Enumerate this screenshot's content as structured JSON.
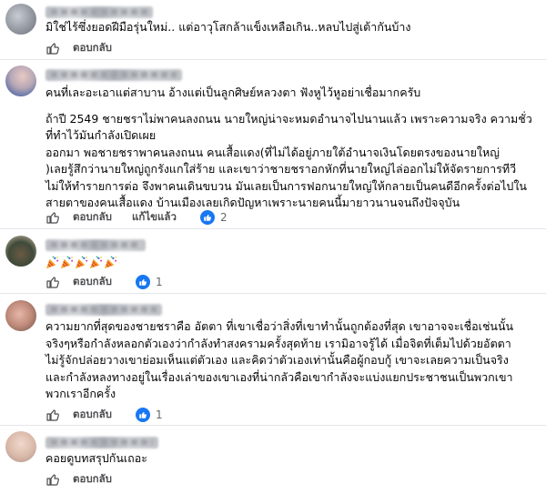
{
  "comments": [
    {
      "lines": [
        "มิใช่ไร้ซึ่งยอดฝีมือรุ่นใหม่.. แต่อาวุโสกล้าแข็งเหลือเกิน..หลบไปสู่เต้ากันบ้าง"
      ],
      "reply_label": "ตอบกลับ"
    },
    {
      "lines": [
        "คนที่เละอะเอาแต่สาบาน อ้างแต่เป็นลูกศิษย์หลวงตา ฟังหูไว้หูอย่าเชื่อมากครับ",
        "",
        "ถ้าปี 2549 ชายชราไม่พาคนลงถนน นายใหญ่น่าจะหมดอำนาจไปนานแล้ว เพราะความจริง ความชั่ว",
        "ที่ทำไว้มันกำลังเปิดเผย",
        "ออกมา พอชายชราพาคนลงถนน คนเสื้อแดง(ที่ไม่ได้อยู่ภายใต้อำนาจเงินโดยตรงของนายใหญ่",
        ")เลยรู้สึกว่านายใหญ่ถูกรังแกใส่ร้าย และเขาว่าชายชราอกหักที่นายใหญ่ไล่ออกไม่ให้จัดรายการทีวี",
        "ไม่ให้ทำรายการต่อ จึงพาคนเดินขบวน มันเลยเป็นการฟอกนายใหญ่ให้กลายเป็นคนดีอีกครั้งต่อไปใน",
        "สายตาของคนเสื้อแดง บ้านเมืองเลยเกิดปัญหาเพราะนายคนนี้มายาวนานจนถึงปัจจุบัน"
      ],
      "reply_label": "ตอบกลับ",
      "edited_label": "แก้ไขแล้ว",
      "reaction_count": "2"
    },
    {
      "emoji_name": "party-popper-icon",
      "emoji_count": 5,
      "reply_label": "ตอบกลับ",
      "reaction_count": "1"
    },
    {
      "lines": [
        "ความยากที่สุดของชายชราคือ อัตตา ที่เขาเชื่อว่าสิ่งที่เขาทำนั้นถูกต้องที่สุด เขาอาจจะเชื่อเช่นนั้น",
        "จริงๆหรือกำลังหลอกตัวเองว่ากำลังทำสงครามครั้งสุดท้าย เรามิอาจรู้ได้ เมื่อจิตที่เต็มไปด้วยอัตตา",
        "ไม่รู้จักปล่อยวางเขาย่อมเห็นแต่ตัวเอง และคิดว่าตัวเองเท่านั้นคือผู้กอบกู้ เขาจะเลยความเป็นจริง",
        "และกำลังหลงทางอยู่ในเรื่องเล่าของเขาเองที่น่ากลัวคือเขากำลังจะแบ่งแยกประชาชนเป็นพวกเขา",
        "พวกเราอีกครั้ง"
      ],
      "reply_label": "ตอบกลับ",
      "reaction_count": "1"
    },
    {
      "lines": [
        "คอยดูบทสรุปกันเถอะ"
      ],
      "reply_label": "ตอบกลับ"
    }
  ],
  "icons": {
    "like": "thumbs-up-icon",
    "reaction": "like-reaction-icon"
  },
  "colors": {
    "reaction_blue": "#1877f2",
    "action_text": "#4b4c4f",
    "divider": "#e4e6eb"
  }
}
